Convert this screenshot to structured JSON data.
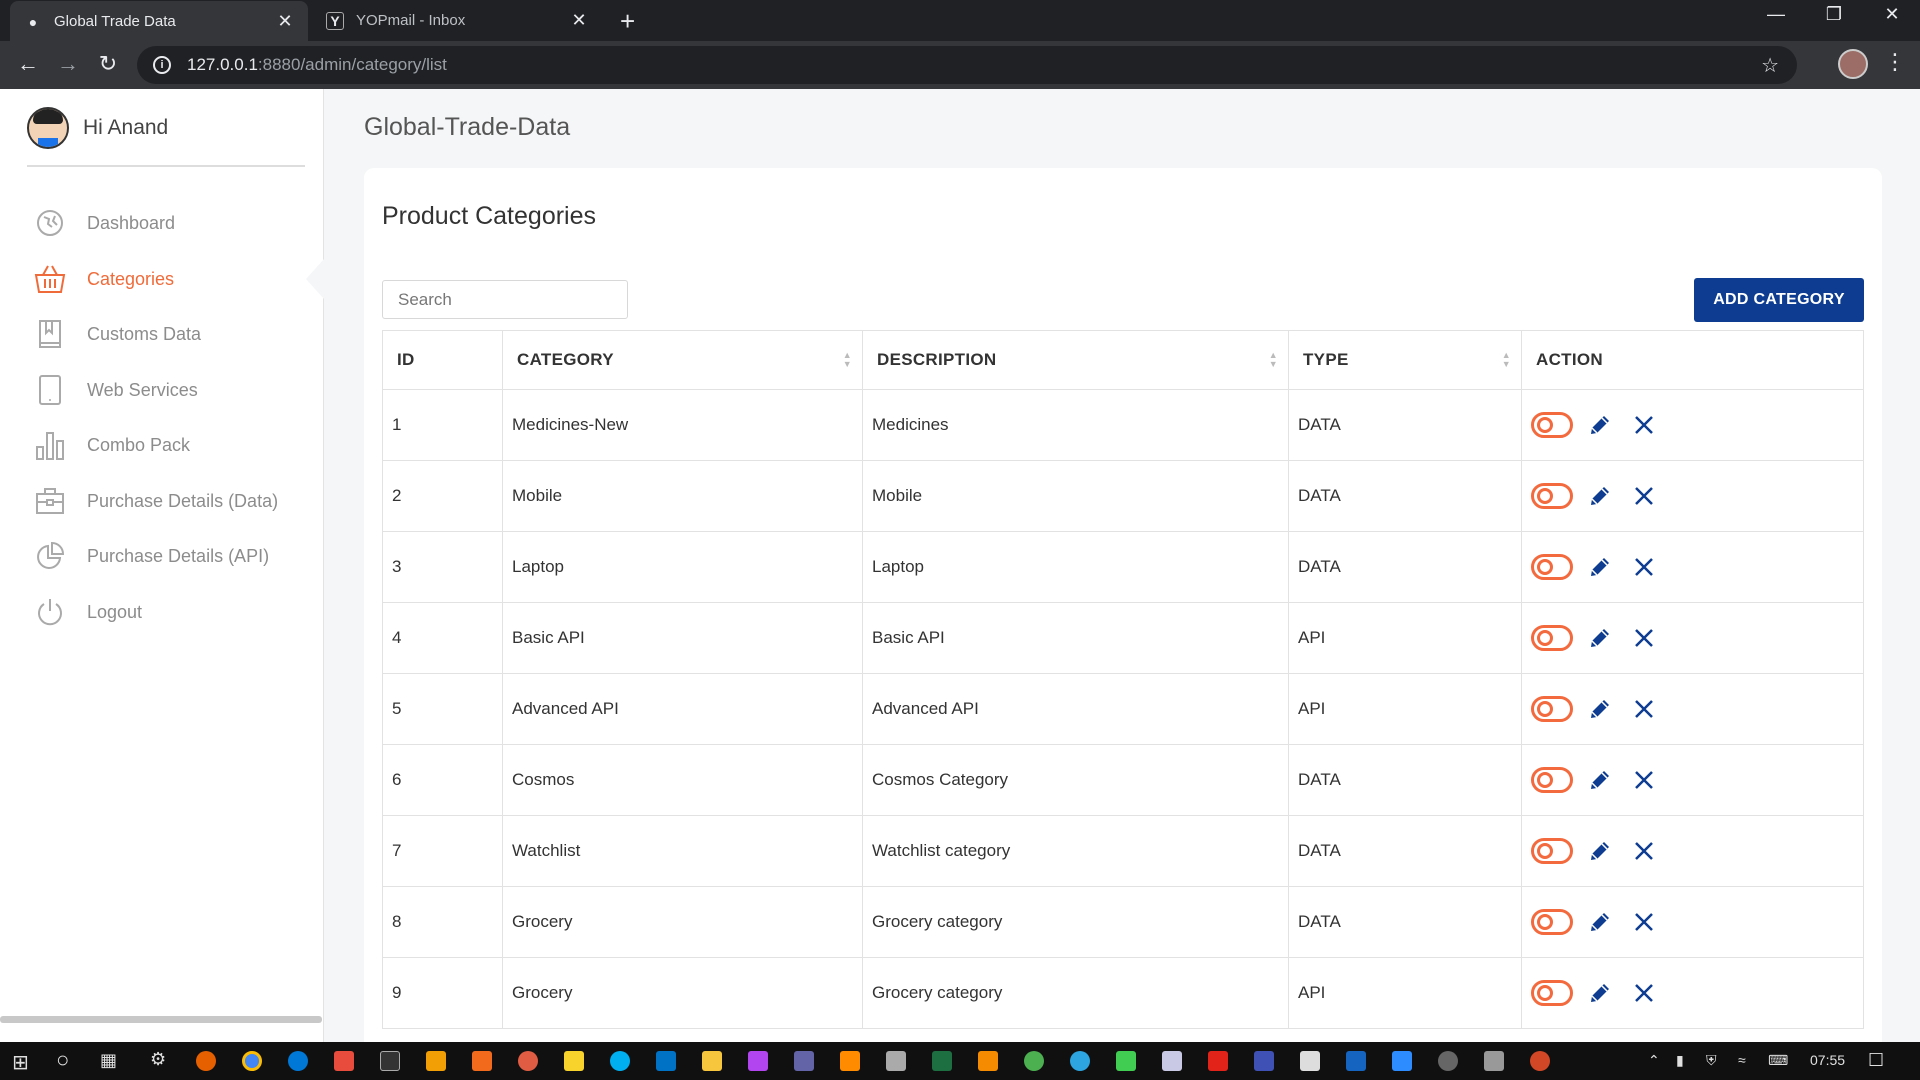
{
  "browser": {
    "tabs": [
      {
        "title": "Global Trade Data",
        "active": true
      },
      {
        "title": "YOPmail - Inbox",
        "active": false
      }
    ],
    "url_host": "127.0.0.1",
    "url_path": ":8880/admin/category/list"
  },
  "sidebar": {
    "greeting": "Hi Anand",
    "items": [
      {
        "label": "Dashboard",
        "icon": "dashboard-icon"
      },
      {
        "label": "Categories",
        "icon": "basket-icon",
        "active": true
      },
      {
        "label": "Customs Data",
        "icon": "book-icon"
      },
      {
        "label": "Web Services",
        "icon": "tablet-icon"
      },
      {
        "label": "Combo Pack",
        "icon": "bar-chart-icon"
      },
      {
        "label": "Purchase Details (Data)",
        "icon": "briefcase-icon"
      },
      {
        "label": "Purchase Details (API)",
        "icon": "pie-chart-icon"
      },
      {
        "label": "Logout",
        "icon": "power-icon"
      }
    ]
  },
  "main": {
    "brand": "Global-Trade-Data",
    "title": "Product Categories",
    "search_placeholder": "Search",
    "add_button": "ADD CATEGORY",
    "columns": [
      "ID",
      "CATEGORY",
      "DESCRIPTION",
      "TYPE",
      "ACTION"
    ],
    "rows": [
      {
        "id": "1",
        "category": "Medicines-New",
        "description": "Medicines",
        "type": "DATA"
      },
      {
        "id": "2",
        "category": "Mobile",
        "description": "Mobile",
        "type": "DATA"
      },
      {
        "id": "3",
        "category": "Laptop",
        "description": "Laptop",
        "type": "DATA"
      },
      {
        "id": "4",
        "category": "Basic API",
        "description": "Basic API",
        "type": "API"
      },
      {
        "id": "5",
        "category": "Advanced API",
        "description": "Advanced API",
        "type": "API"
      },
      {
        "id": "6",
        "category": "Cosmos",
        "description": "Cosmos Category",
        "type": "DATA"
      },
      {
        "id": "7",
        "category": "Watchlist",
        "description": "Watchlist category",
        "type": "DATA"
      },
      {
        "id": "8",
        "category": "Grocery",
        "description": "Grocery category",
        "type": "DATA"
      },
      {
        "id": "9",
        "category": "Grocery",
        "description": "Grocery category",
        "type": "API"
      }
    ]
  },
  "taskbar": {
    "clock": "07:55"
  },
  "colors": {
    "accent": "#f06b3a",
    "primary_button": "#0d3c91",
    "icon_blue": "#0d3c91"
  }
}
